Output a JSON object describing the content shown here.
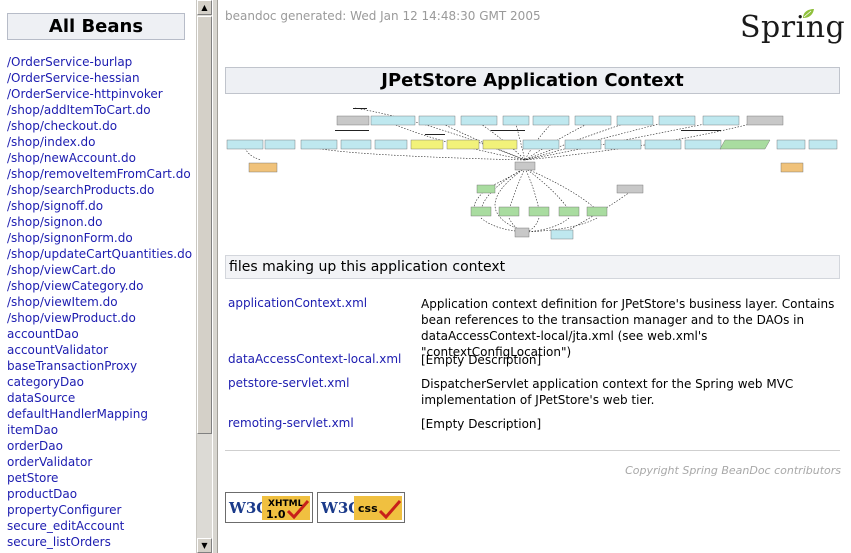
{
  "sidebar": {
    "title": "All Beans",
    "beans": [
      "/OrderService-burlap",
      "/OrderService-hessian",
      "/OrderService-httpinvoker",
      "/shop/addItemToCart.do",
      "/shop/checkout.do",
      "/shop/index.do",
      "/shop/newAccount.do",
      "/shop/removeItemFromCart.do",
      "/shop/searchProducts.do",
      "/shop/signoff.do",
      "/shop/signon.do",
      "/shop/signonForm.do",
      "/shop/updateCartQuantities.do",
      "/shop/viewCart.do",
      "/shop/viewCategory.do",
      "/shop/viewItem.do",
      "/shop/viewProduct.do",
      "accountDao",
      "accountValidator",
      "baseTransactionProxy",
      "categoryDao",
      "dataSource",
      "defaultHandlerMapping",
      "itemDao",
      "orderDao",
      "orderValidator",
      "petStore",
      "productDao",
      "propertyConfigurer",
      "secure_editAccount",
      "secure_listOrders"
    ]
  },
  "header": {
    "generated": "beandoc generated: Wed Jan 12 14:48:30 GMT 2005",
    "logo_text": "Spring"
  },
  "main": {
    "title": "JPetStore Application Context",
    "files_heading": "files making up this application context",
    "files": [
      {
        "name": "applicationContext.xml",
        "description": "Application context definition for JPetStore's business layer. Contains bean references to the transaction manager and to the DAOs in dataAccessContext-local/jta.xml (see web.xml's \"contextConfigLocation\")"
      },
      {
        "name": "dataAccessContext-local.xml",
        "description": "[Empty Description]"
      },
      {
        "name": "petstore-servlet.xml",
        "description": "DispatcherServlet application context for the Spring web MVC implementation of JPetStore's web tier."
      },
      {
        "name": "remoting-servlet.xml",
        "description": "[Empty Description]"
      }
    ],
    "copyright": "Copyright Spring BeanDoc contributors"
  },
  "badges": {
    "xhtml": {
      "w3c": "W3C",
      "label": "XHTML",
      "version": "1.0"
    },
    "css": {
      "w3c": "W3C",
      "label": "css"
    }
  },
  "colors": {
    "link": "#1c1cb0",
    "node_cyan": "#bfe8ef",
    "node_yellow": "#f2f27a",
    "node_orange": "#f0c27a",
    "node_green": "#a9dca0",
    "node_gray": "#c8c8c8",
    "check_red": "#c8201a",
    "badge_gold": "#f0c040"
  },
  "icons": {
    "scroll_up": "arrow-up-icon",
    "scroll_down": "arrow-down-icon",
    "logo_leaf": "leaf-icon"
  }
}
